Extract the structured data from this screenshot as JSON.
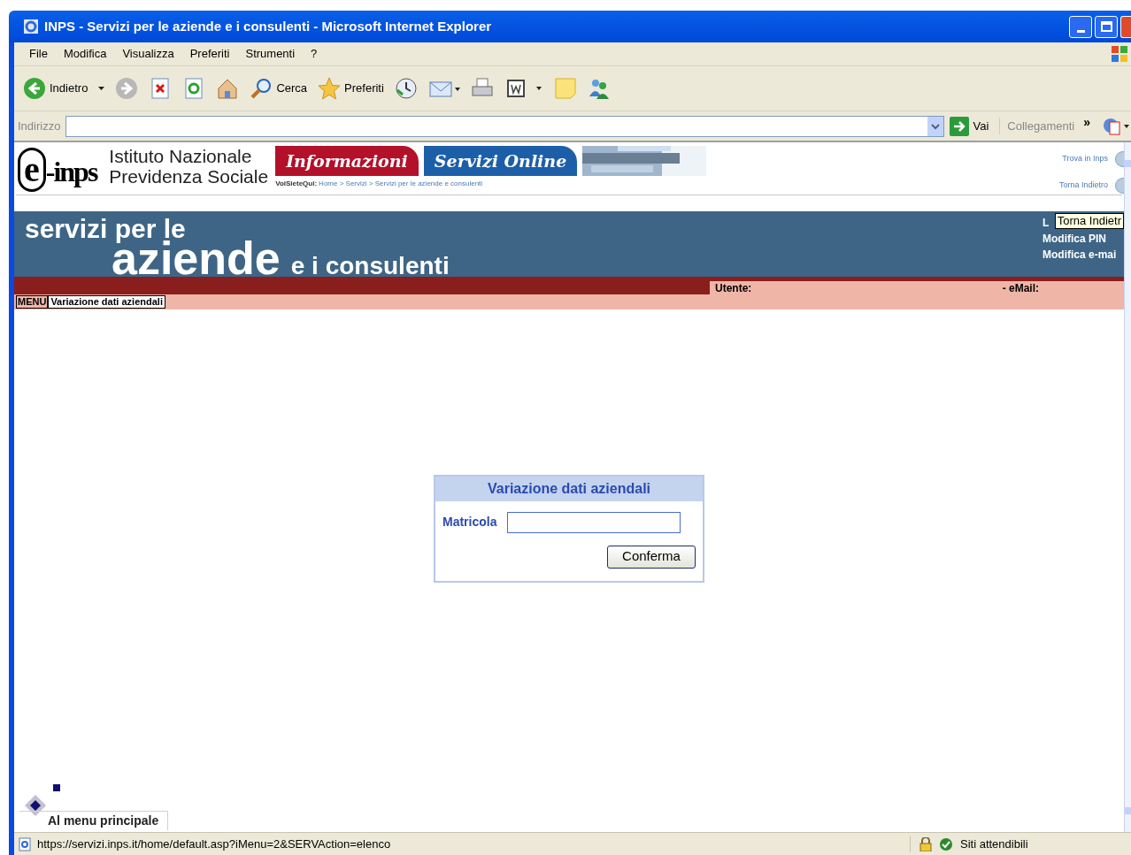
{
  "window": {
    "title": "INPS - Servizi per le aziende e i consulenti - Microsoft Internet Explorer"
  },
  "menu_bar": [
    "File",
    "Modifica",
    "Visualizza",
    "Preferiti",
    "Strumenti",
    "?"
  ],
  "toolbar": [
    {
      "kind": "back",
      "label": "Indietro"
    },
    {
      "kind": "forward"
    },
    {
      "kind": "stop"
    },
    {
      "kind": "refresh"
    },
    {
      "kind": "home"
    },
    {
      "kind": "search",
      "label": "Cerca"
    },
    {
      "kind": "favorites",
      "label": "Preferiti"
    },
    {
      "kind": "history"
    },
    {
      "kind": "mail"
    },
    {
      "kind": "print"
    },
    {
      "kind": "word"
    },
    {
      "kind": "note"
    },
    {
      "kind": "messenger"
    }
  ],
  "address_bar": {
    "label": "Indirizzo",
    "go": "Vai",
    "links": "Collegamenti",
    "chevron": "»"
  },
  "site_header": {
    "logo_mark": "e",
    "logo_text": "-inps",
    "org_name": [
      "Istituto Nazionale",
      "Previdenza Sociale"
    ],
    "tabs": [
      {
        "label": "Informazioni",
        "color": "#b3102a"
      },
      {
        "label": "Servizi Online",
        "color": "#1c5fa8"
      }
    ],
    "breadcrumb_label": "VoiSieteQui:",
    "breadcrumb": "Home > Servizi > Servizi per le aziende e consulenti",
    "links": [
      "Trova in Inps",
      "Torna Indietro"
    ]
  },
  "banner": {
    "line1": "servizi per le",
    "line2": "aziende",
    "line3": "e i consulenti",
    "user_links": [
      "L",
      "Modifica PIN",
      "Modifica e-mai"
    ],
    "tooltip": "Torna Indietr"
  },
  "user_bar": {
    "user_label": "Utente:",
    "email_label": "- eMail:"
  },
  "menu_path": {
    "menu": "MENU",
    "current": "Variazione dati aziendali"
  },
  "form": {
    "title": "Variazione dati aziendali",
    "field_label": "Matricola",
    "button": "Conferma"
  },
  "footer_link": "Al menu principale",
  "status_bar": {
    "url": "https://servizi.inps.it/home/default.asp?iMenu=2&SERVAction=elenco",
    "zone": "Siti attendibili"
  }
}
